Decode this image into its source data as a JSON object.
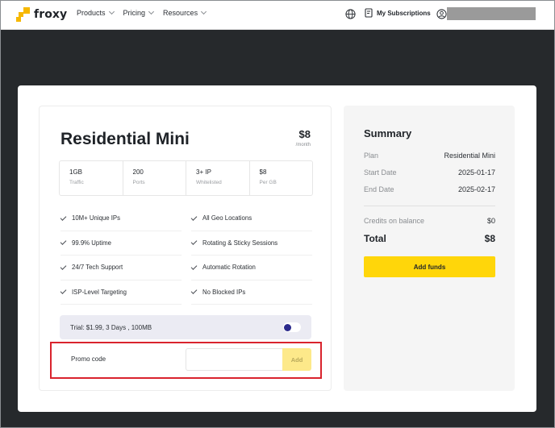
{
  "header": {
    "logo_text": "froxy",
    "nav": [
      {
        "label": "Products"
      },
      {
        "label": "Pricing"
      },
      {
        "label": "Resources"
      }
    ],
    "subscriptions_label": "My Subscriptions",
    "icons": [
      "globe-icon",
      "subscriptions-icon",
      "user-icon",
      "chevron-down-icon"
    ]
  },
  "plan": {
    "title": "Residential Mini",
    "price": "$8",
    "period": "/month",
    "stats": [
      {
        "value": "1GB",
        "label": "Traffic"
      },
      {
        "value": "200",
        "label": "Ports"
      },
      {
        "value": "3+ IP",
        "label": "Whitelisted"
      },
      {
        "value": "$8",
        "label": "Per GB"
      }
    ],
    "features": [
      [
        "10M+ Unique IPs",
        "All Geo Locations"
      ],
      [
        "99.9% Uptime",
        "Rotating & Sticky Sessions"
      ],
      [
        "24/7 Tech Support",
        "Automatic Rotation"
      ],
      [
        "ISP-Level Targeting",
        "No Blocked IPs"
      ]
    ],
    "trial_label": "Trial: $1.99, 3 Days , 100MB",
    "trial_enabled": false
  },
  "promo": {
    "label": "Promo code",
    "value": "",
    "add_label": "Add"
  },
  "summary": {
    "title": "Summary",
    "rows": [
      {
        "key": "Plan",
        "value": "Residential Mini"
      },
      {
        "key": "Start Date",
        "value": "2025-01-17"
      },
      {
        "key": "End Date",
        "value": "2025-02-17"
      }
    ],
    "credits_label": "Credits on balance",
    "credits_value": "$0",
    "total_label": "Total",
    "total_value": "$8",
    "add_funds_label": "Add funds"
  },
  "colors": {
    "accent": "#ffd60a",
    "logo": "#f6b800",
    "highlight_box": "#d9232d",
    "background": "#26292c"
  }
}
